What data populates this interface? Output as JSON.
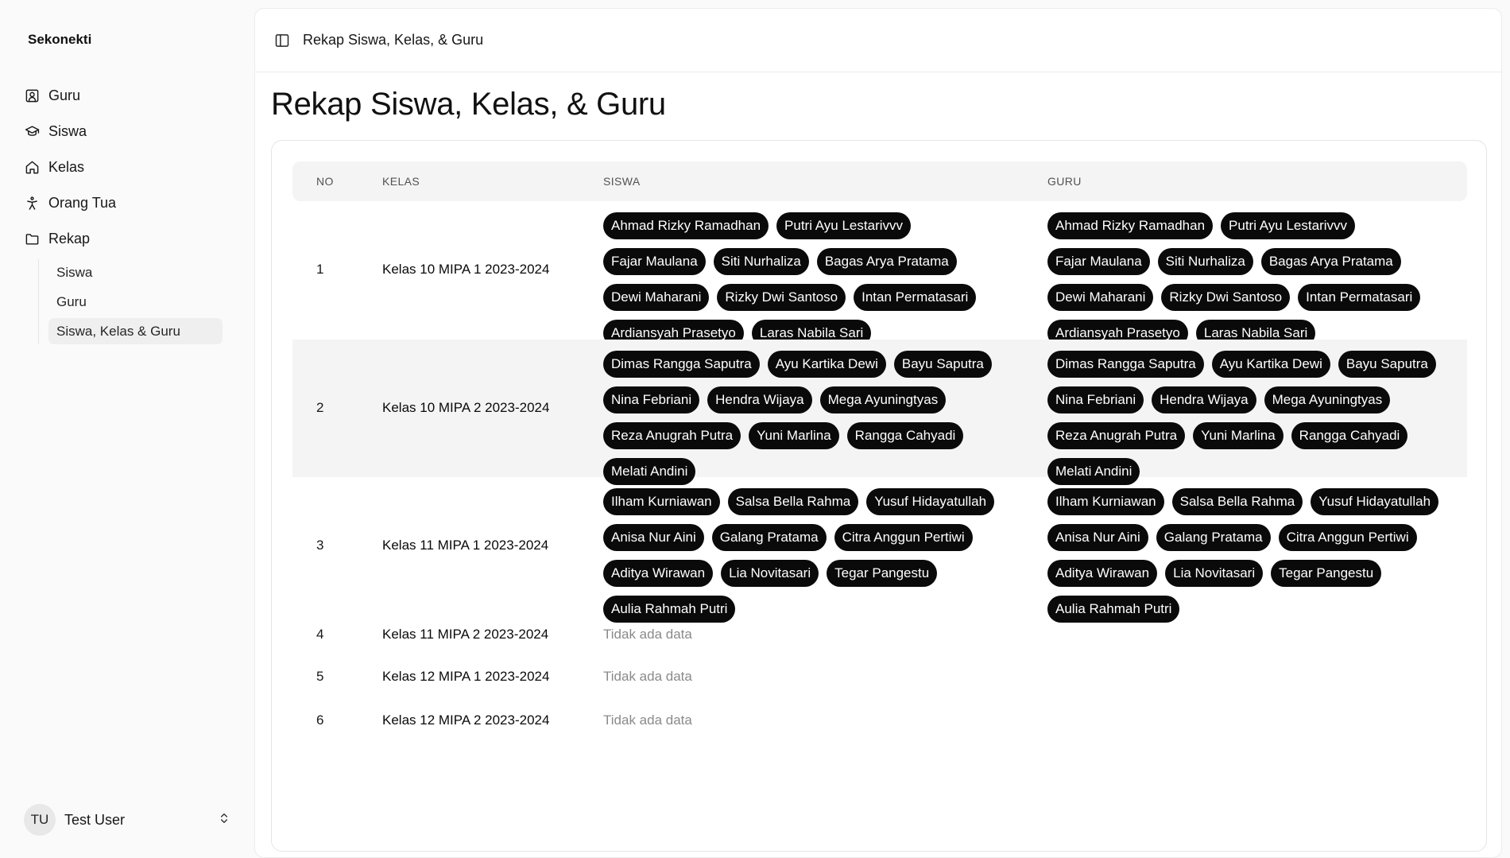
{
  "sidebar": {
    "brand": "Sekonekti",
    "items": [
      {
        "label": "Guru",
        "icon": "user-square-icon"
      },
      {
        "label": "Siswa",
        "icon": "graduation-cap-icon"
      },
      {
        "label": "Kelas",
        "icon": "home-icon"
      },
      {
        "label": "Orang Tua",
        "icon": "person-icon"
      },
      {
        "label": "Rekap",
        "icon": "folder-icon"
      }
    ],
    "rekap_sub": [
      "Siswa",
      "Guru",
      "Siswa, Kelas & Guru"
    ],
    "active_sub": "Siswa, Kelas & Guru",
    "user": {
      "initials": "TU",
      "name": "Test User"
    }
  },
  "header": {
    "breadcrumb": "Rekap Siswa, Kelas, & Guru"
  },
  "main": {
    "title": "Rekap Siswa, Kelas, & Guru",
    "table": {
      "headers": {
        "no": "NO",
        "kelas": "KELAS",
        "siswa": "SISWA",
        "guru": "GURU"
      },
      "rows": [
        {
          "no": "1",
          "kelas": "Kelas 10 MIPA 1 2023-2024",
          "siswa": [
            "Ahmad Rizky Ramadhan",
            "Putri Ayu Lestarivvv",
            "Fajar Maulana",
            "Siti Nurhaliza",
            "Bagas Arya Pratama",
            "Dewi Maharani",
            "Rizky Dwi Santoso",
            "Intan Permatasari",
            "Ardiansyah Prasetyo",
            "Laras Nabila Sari"
          ],
          "guru": [
            "Ahmad Rizky Ramadhan",
            "Putri Ayu Lestarivvv",
            "Fajar Maulana",
            "Siti Nurhaliza",
            "Bagas Arya Pratama",
            "Dewi Maharani",
            "Rizky Dwi Santoso",
            "Intan Permatasari",
            "Ardiansyah Prasetyo",
            "Laras Nabila Sari"
          ]
        },
        {
          "no": "2",
          "kelas": "Kelas 10 MIPA 2 2023-2024",
          "siswa": [
            "Dimas Rangga Saputra",
            "Ayu Kartika Dewi",
            "Bayu Saputra",
            "Nina Febriani",
            "Hendra Wijaya",
            "Mega Ayuningtyas",
            "Reza Anugrah Putra",
            "Yuni Marlina",
            "Rangga Cahyadi",
            "Melati Andini"
          ],
          "guru": [
            "Dimas Rangga Saputra",
            "Ayu Kartika Dewi",
            "Bayu Saputra",
            "Nina Febriani",
            "Hendra Wijaya",
            "Mega Ayuningtyas",
            "Reza Anugrah Putra",
            "Yuni Marlina",
            "Rangga Cahyadi",
            "Melati Andini"
          ]
        },
        {
          "no": "3",
          "kelas": "Kelas 11 MIPA 1 2023-2024",
          "siswa": [
            "Ilham Kurniawan",
            "Salsa Bella Rahma",
            "Yusuf Hidayatullah",
            "Anisa Nur Aini",
            "Galang Pratama",
            "Citra Anggun Pertiwi",
            "Aditya Wirawan",
            "Lia Novitasari",
            "Tegar Pangestu",
            "Aulia Rahmah Putri"
          ],
          "guru": [
            "Ilham Kurniawan",
            "Salsa Bella Rahma",
            "Yusuf Hidayatullah",
            "Anisa Nur Aini",
            "Galang Pratama",
            "Citra Anggun Pertiwi",
            "Aditya Wirawan",
            "Lia Novitasari",
            "Tegar Pangestu",
            "Aulia Rahmah Putri"
          ]
        },
        {
          "no": "4",
          "kelas": "Kelas 11 MIPA 2 2023-2024",
          "siswa": [],
          "guru": [],
          "empty": "Tidak ada data"
        },
        {
          "no": "5",
          "kelas": "Kelas 12 MIPA 1 2023-2024",
          "siswa": [],
          "guru": [],
          "empty": "Tidak ada data"
        },
        {
          "no": "6",
          "kelas": "Kelas 12 MIPA 2 2023-2024",
          "siswa": [],
          "guru": [],
          "empty": "Tidak ada data"
        }
      ]
    }
  }
}
